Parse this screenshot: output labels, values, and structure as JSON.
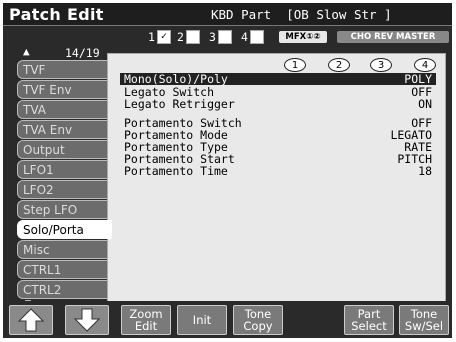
{
  "header": {
    "title": "Patch Edit",
    "part_info": "KBD Part  [OB Slow Str ]"
  },
  "parts": [
    {
      "label": "1",
      "checked": true
    },
    {
      "label": "2",
      "checked": false
    },
    {
      "label": "3",
      "checked": false
    },
    {
      "label": "4",
      "checked": false
    }
  ],
  "mfx": [
    {
      "label": "MFX①②",
      "active": true
    },
    {
      "label": "CHO REV MASTER",
      "active": false
    }
  ],
  "sidebar": {
    "counter": "14/19",
    "items": [
      {
        "label": "TVF"
      },
      {
        "label": "TVF Env"
      },
      {
        "label": "TVA"
      },
      {
        "label": "TVA Env"
      },
      {
        "label": "Output"
      },
      {
        "label": "LFO1"
      },
      {
        "label": "LFO2"
      },
      {
        "label": "Step LFO"
      },
      {
        "label": "Solo/Porta"
      },
      {
        "label": "Misc"
      },
      {
        "label": "CTRL1"
      },
      {
        "label": "CTRL2"
      }
    ],
    "selected_index": 8
  },
  "tone_switches": [
    "1",
    "2",
    "3",
    "4"
  ],
  "params": [
    {
      "label": "Mono(Solo)/Poly",
      "value": "POLY"
    },
    {
      "label": "Legato Switch",
      "value": "OFF"
    },
    {
      "label": "Legato Retrigger",
      "value": "ON"
    },
    {
      "label": "Portamento Switch",
      "value": "OFF"
    },
    {
      "label": "Portamento Mode",
      "value": "LEGATO"
    },
    {
      "label": "Portamento Type",
      "value": "RATE"
    },
    {
      "label": "Portamento Start",
      "value": "PITCH"
    },
    {
      "label": "Portamento Time",
      "value": "18"
    }
  ],
  "footer": {
    "zoom_edit": "Zoom Edit",
    "init": "Init",
    "tone_copy": "Tone Copy",
    "part_select": "Part Select",
    "tone_sw_sel": "Tone Sw/Sel"
  },
  "colors": {
    "background": "#2a2a2a",
    "panel": "#e9e9e9",
    "tab": "#6c6c6c",
    "button": "#7a7a7a",
    "highlight_row": "#222222"
  },
  "icons": [
    "up-arrow-icon",
    "down-arrow-icon",
    "scroll-up-icon",
    "scroll-down-icon"
  ]
}
